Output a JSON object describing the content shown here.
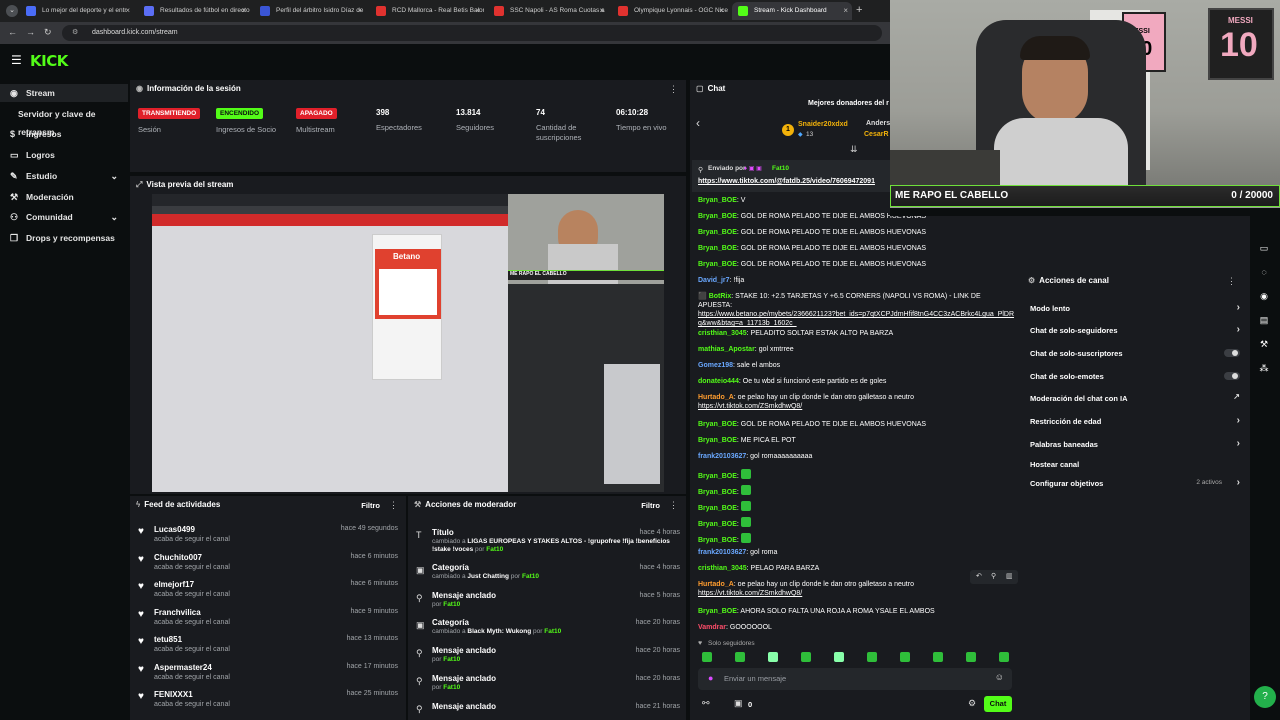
{
  "browser": {
    "tabs": [
      {
        "label": "Lo mejor del deporte y el entr",
        "color": "#4a6cf7"
      },
      {
        "label": "Resultados de fútbol en directo",
        "color": "#5b6ef5"
      },
      {
        "label": "Perfil del árbitro Isidro Díaz de",
        "color": "#3a55d6"
      },
      {
        "label": "RCD Mallorca - Real Betis Balom",
        "color": "#e0322f"
      },
      {
        "label": "SSC Napoli - AS Roma Cuotas a",
        "color": "#e0322f"
      },
      {
        "label": "Olympique Lyonnais - OGC Nice",
        "color": "#e0322f"
      },
      {
        "label": "Stream - Kick Dashboard",
        "color": "#53fc18"
      }
    ],
    "url": "dashboard.kick.com/stream"
  },
  "brand": {
    "logo": "KICK",
    "accent": "#53fc18"
  },
  "sidebar": {
    "items": [
      {
        "label": "Stream",
        "icon": "broadcast-icon"
      },
      {
        "label": "Servidor y clave de retransm",
        "icon": ""
      },
      {
        "label": "Ingresos",
        "icon": "dollar-icon"
      },
      {
        "label": "Logros",
        "icon": "chat-icon"
      },
      {
        "label": "Estudio",
        "icon": "pencil-icon"
      },
      {
        "label": "Moderación",
        "icon": "wrench-icon"
      },
      {
        "label": "Comunidad",
        "icon": "people-icon"
      },
      {
        "label": "Drops y recompensas",
        "icon": "gift-icon"
      }
    ]
  },
  "session": {
    "title": "Información de la sesión",
    "stats": [
      {
        "badge": "TRANSMITIENDO",
        "label": "Sesión",
        "badge_bg": "#e0202a",
        "badge_fg": "#ffffff"
      },
      {
        "badge": "ENCENDIDO",
        "label": "Ingresos de Socio",
        "badge_bg": "#53fc18",
        "badge_fg": "#0b0e0f"
      },
      {
        "badge": "APAGADO",
        "label": "Multistream",
        "badge_bg": "#e0202a",
        "badge_fg": "#ffffff"
      },
      {
        "value": "398",
        "label": "Espectadores"
      },
      {
        "value": "13.814",
        "label": "Seguidores"
      },
      {
        "value": "74",
        "label": "Cantidad de suscripciones"
      },
      {
        "value": "06:10:28",
        "label": "Tiempo en vivo"
      }
    ]
  },
  "preview": {
    "title": "Vista previa del stream",
    "betano": "Betano",
    "cam_caption": "ME RAPO EL CABELLO"
  },
  "activity": {
    "title": "Feed de actividades",
    "filter": "Filtro",
    "items": [
      {
        "name": "Lucas0499",
        "sub": "acaba de seguir el canal",
        "time": "hace 49 segundos"
      },
      {
        "name": "Chuchito007",
        "sub": "acaba de seguir el canal",
        "time": "hace 6 minutos"
      },
      {
        "name": "elmejorf17",
        "sub": "acaba de seguir el canal",
        "time": "hace 6 minutos"
      },
      {
        "name": "Franchvilica",
        "sub": "acaba de seguir el canal",
        "time": "hace 9 minutos"
      },
      {
        "name": "tetu851",
        "sub": "acaba de seguir el canal",
        "time": "hace 13 minutos"
      },
      {
        "name": "Aspermaster24",
        "sub": "acaba de seguir el canal",
        "time": "hace 17 minutos"
      },
      {
        "name": "FENIXXX1",
        "sub": "acaba de seguir el canal",
        "time": "hace 25 minutos"
      }
    ]
  },
  "moderator": {
    "title": "Acciones de moderador",
    "filter": "Filtro",
    "items": [
      {
        "title": "Título",
        "pre": "cambiado a",
        "value": "LIGAS EUROPEAS Y STAKES ALTOS - !grupofree !fija !beneficios !stake !voces",
        "by": "por",
        "user": "Fat10",
        "time": "hace 4 horas",
        "icon": "text-icon"
      },
      {
        "title": "Categoría",
        "pre": "cambiado a",
        "value": "Just Chatting",
        "by": "por",
        "user": "Fat10",
        "time": "hace 4 horas",
        "icon": "category-icon"
      },
      {
        "title": "Mensaje anclado",
        "pre": "por",
        "value": "",
        "by": "",
        "user": "Fat10",
        "time": "hace 5 horas",
        "icon": "pin-icon"
      },
      {
        "title": "Categoría",
        "pre": "cambiado a",
        "value": "Black Myth: Wukong",
        "by": "por",
        "user": "Fat10",
        "time": "hace 20 horas",
        "icon": "category-icon"
      },
      {
        "title": "Mensaje anclado",
        "pre": "por",
        "value": "",
        "by": "",
        "user": "Fat10",
        "time": "hace 20 horas",
        "icon": "pin-icon"
      },
      {
        "title": "Mensaje anclado",
        "pre": "por",
        "value": "",
        "by": "",
        "user": "Fat10",
        "time": "hace 20 horas",
        "icon": "pin-icon"
      },
      {
        "title": "Mensaje anclado",
        "pre": "",
        "value": "",
        "by": "",
        "user": "",
        "time": "hace 21 horas",
        "icon": "pin-icon"
      }
    ]
  },
  "chat": {
    "title": "Chat",
    "donors_title": "Mejores donadores del r",
    "donor1": "Snaider20xdxd",
    "donor1_count": "13",
    "donor2": "Anders",
    "donor3": "CesarR",
    "pinned_by_label": "Enviado por",
    "pinned_user": "Fat10",
    "pinned_link": "https://www.tiktok.com/@fatdb.25/video/76069472091",
    "messages": [
      {
        "user": "Bryan_BOE",
        "color": "#53fc18",
        "text": "V"
      },
      {
        "user": "Bryan_BOE",
        "color": "#53fc18",
        "text": "GOL DE ROMA PELADO TE DIJE EL AMBOS HUEVONAS"
      },
      {
        "user": "Bryan_BOE",
        "color": "#53fc18",
        "text": "GOL DE ROMA PELADO TE DIJE EL AMBOS HUEVONAS"
      },
      {
        "user": "Bryan_BOE",
        "color": "#53fc18",
        "text": "GOL DE ROMA PELADO TE DIJE EL AMBOS HUEVONAS"
      },
      {
        "user": "Bryan_BOE",
        "color": "#53fc18",
        "text": "GOL DE ROMA PELADO TE DIJE EL AMBOS HUEVONAS"
      },
      {
        "user": "David_jr7",
        "color": "#6aa8ff",
        "text": "!fija"
      },
      {
        "user": "BotRix",
        "color": "#53fc18",
        "text": "STAKE 10: +2.5 TARJETAS Y +6.5 CORNERS (NAPOLI VS ROMA) - LINK DE APUESTA:",
        "link": "https://www.betano.pe/mybets/2366621123?bet_ids=p7qtXCPJdmHfif8tnG4CC3zACBrkc4Lgua_PlDRq&ww&btag=a_11713b_1602c_"
      },
      {
        "user": "cristhian_3045",
        "color": "#53fc18",
        "text": "PELADITO SOLTAR ESTAK ALTO PA BARZA"
      },
      {
        "user": "mathias_Apostar",
        "color": "#53fc18",
        "text": "gol xmtrree"
      },
      {
        "user": "Gomez198",
        "color": "#6aa8ff",
        "text": "sale el ambos"
      },
      {
        "user": "donateio444",
        "color": "#53fc18",
        "text": "Oe tu wbd si funcionó este partido es de goles"
      },
      {
        "user": "Hurtado_A",
        "color": "#ff9d2f",
        "text": "oe pelao hay un clip donde le dan otro galletaso a neutro",
        "link": "https://vt.tiktok.com/ZSmkdhwQ8/"
      },
      {
        "user": "Bryan_BOE",
        "color": "#53fc18",
        "text": "GOL DE ROMA PELADO TE DIJE EL AMBOS HUEVONAS"
      },
      {
        "user": "Bryan_BOE",
        "color": "#53fc18",
        "text": "ME PICA EL POT"
      },
      {
        "user": "frank20103627",
        "color": "#6aa8ff",
        "text": "gol romaaaaaaaaaa"
      },
      {
        "user": "Bryan_BOE",
        "color": "#53fc18",
        "text": "",
        "emote": true
      },
      {
        "user": "Bryan_BOE",
        "color": "#53fc18",
        "text": "",
        "emote": true
      },
      {
        "user": "Bryan_BOE",
        "color": "#53fc18",
        "text": "",
        "emote": true
      },
      {
        "user": "Bryan_BOE",
        "color": "#53fc18",
        "text": "",
        "emote": true
      },
      {
        "user": "Bryan_BOE",
        "color": "#53fc18",
        "text": "",
        "emote": true
      },
      {
        "user": "frank20103627",
        "color": "#6aa8ff",
        "text": "gol roma"
      },
      {
        "user": "cristhian_3045",
        "color": "#53fc18",
        "text": "PELAO PARA BARZA"
      },
      {
        "user": "Hurtado_A",
        "color": "#ff9d2f",
        "text": "oe pelao hay un clip donde le dan otro galletaso a neutro",
        "link": "https://vt.tiktok.com/ZSmkdhwQ8/"
      },
      {
        "user": "Bryan_BOE",
        "color": "#53fc18",
        "text": "AHORA SOLO FALTA UNA ROJA A ROMA YSALE EL AMBOS"
      },
      {
        "user": "Vamdrar",
        "color": "#ff4d6a",
        "text": "GOOOOOOL"
      }
    ],
    "followers_only": "Solo seguidores",
    "input_placeholder": "Enviar un mensaje",
    "points": "0",
    "send_label": "Chat"
  },
  "channel_actions": {
    "title": "Acciones de canal",
    "items": [
      {
        "label": "Modo lento",
        "control": "chevron"
      },
      {
        "label": "Chat de solo-seguidores",
        "control": "chevron"
      },
      {
        "label": "Chat de solo-suscriptores",
        "control": "toggle"
      },
      {
        "label": "Chat de solo-emotes",
        "control": "toggle"
      },
      {
        "label": "Moderación del chat con IA",
        "control": "external"
      },
      {
        "label": "Restricción de edad",
        "control": "chevron"
      },
      {
        "label": "Palabras baneadas",
        "control": "chevron"
      },
      {
        "label": "Hostear canal",
        "control": "none"
      },
      {
        "label": "Configurar objetivos",
        "control": "chevron",
        "extra": "2 activos"
      }
    ]
  },
  "webcam": {
    "overlay_text": "ME RAPO EL CABELLO",
    "counter": "0  /  20000",
    "jersey": "MESSI",
    "jersey_number": "10"
  }
}
